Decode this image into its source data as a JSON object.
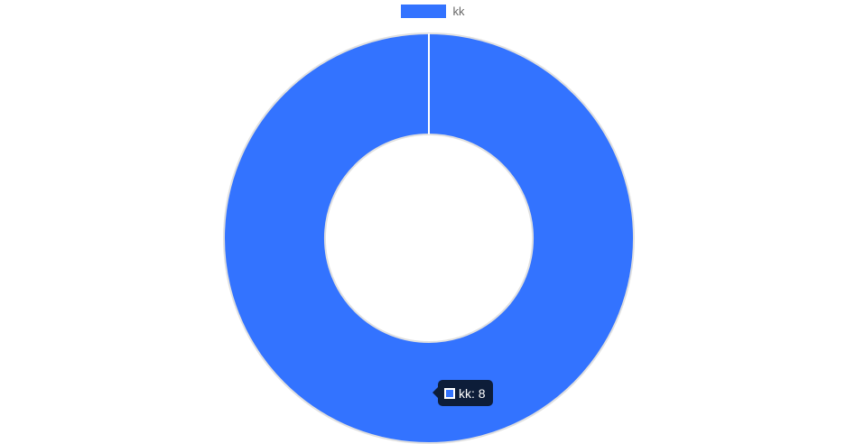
{
  "chart_data": {
    "type": "pie",
    "variant": "doughnut",
    "categories": [
      "kk"
    ],
    "values": [
      8
    ],
    "series": [
      {
        "name": "kk",
        "values": [
          8
        ]
      }
    ],
    "colors": [
      "#3373ff"
    ],
    "border_color": "#e0e0e0",
    "title": "",
    "legend": {
      "position": "top-center",
      "entries": [
        "kk"
      ]
    }
  },
  "tooltip": {
    "label": "kk",
    "value": "8",
    "text": "kk: 8",
    "color": "#3373ff"
  }
}
